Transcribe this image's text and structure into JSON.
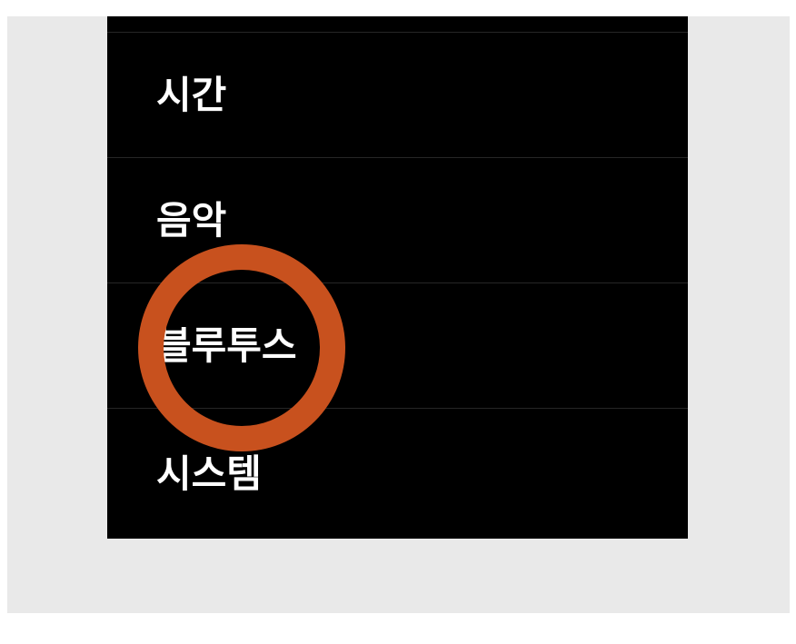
{
  "menu": {
    "items": [
      {
        "label": "시간"
      },
      {
        "label": "음악"
      },
      {
        "label": "블루투스"
      },
      {
        "label": "시스템"
      }
    ]
  },
  "tap_indicator": {
    "target_item": "블루투스",
    "color": "#c8511e"
  },
  "colors": {
    "screen_background": "#000000",
    "panel_background": "#e9e9e9",
    "text": "#ffffff",
    "divider": "#262626"
  }
}
